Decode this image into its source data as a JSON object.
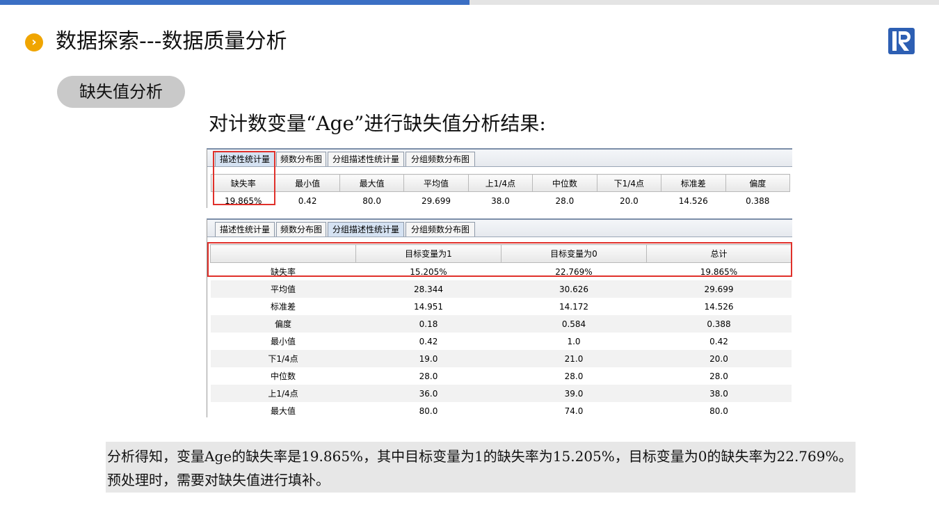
{
  "colors": {
    "topbar_blue": "#3b6fc4",
    "bullet": "#f0a500",
    "highlight": "#e0302a",
    "logo": "#2d5fb3"
  },
  "header": {
    "bullet_icon": "chevron-right-icon",
    "title": "数据探索---数据质量分析",
    "logo_icon": "r-logo-icon"
  },
  "section_pill": "缺失值分析",
  "subtitle": "对计数变量“Age”进行缺失值分析结果:",
  "tabs": [
    "描述性统计量",
    "频数分布图",
    "分组描述性统计量",
    "分组频数分布图"
  ],
  "table1": {
    "active_tab": 0,
    "headers": [
      "缺失率",
      "最小值",
      "最大值",
      "平均值",
      "上1/4点",
      "中位数",
      "下1/4点",
      "标准差",
      "偏度"
    ],
    "values": [
      "19.865%",
      "0.42",
      "80.0",
      "29.699",
      "38.0",
      "28.0",
      "20.0",
      "14.526",
      "0.388"
    ]
  },
  "table2": {
    "active_tab": 2,
    "headers": [
      "",
      "目标变量为1",
      "目标变量为0",
      "总计"
    ],
    "rows": [
      [
        "缺失率",
        "15.205%",
        "22.769%",
        "19.865%"
      ],
      [
        "平均值",
        "28.344",
        "30.626",
        "29.699"
      ],
      [
        "标准差",
        "14.951",
        "14.172",
        "14.526"
      ],
      [
        "偏度",
        "0.18",
        "0.584",
        "0.388"
      ],
      [
        "最小值",
        "0.42",
        "1.0",
        "0.42"
      ],
      [
        "下1/4点",
        "19.0",
        "21.0",
        "20.0"
      ],
      [
        "中位数",
        "28.0",
        "28.0",
        "28.0"
      ],
      [
        "上1/4点",
        "36.0",
        "39.0",
        "38.0"
      ],
      [
        "最大值",
        "80.0",
        "74.0",
        "80.0"
      ]
    ]
  },
  "conclusion": "分析得知，变量Age的缺失率是19.865%，其中目标变量为1的缺失率为15.205%，目标变量为0的缺失率为22.769%。预处理时，需要对缺失值进行填补。"
}
